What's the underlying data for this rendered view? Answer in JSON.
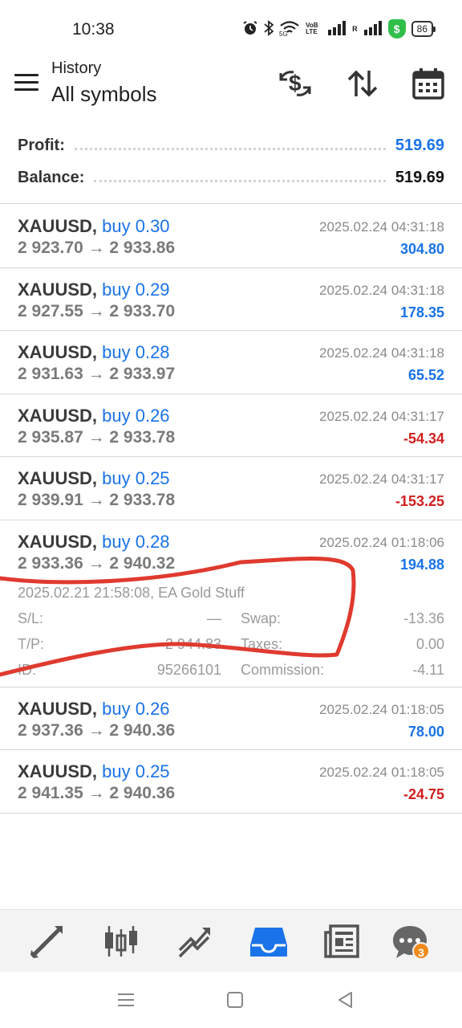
{
  "status": {
    "time": "10:38",
    "network": "5G",
    "volte": "VoB LTE",
    "roaming": "R",
    "shield": "$",
    "battery": "86"
  },
  "header": {
    "subtitle": "History",
    "title": "All symbols"
  },
  "summary": {
    "profit_label": "Profit:",
    "profit_value": "519.69",
    "balance_label": "Balance:",
    "balance_value": "519.69"
  },
  "trades": [
    {
      "symbol": "XAUUSD,",
      "side": "buy 0.30",
      "prices": "2 923.70 → 2 933.86",
      "time": "2025.02.24 04:31:18",
      "profit": "304.80",
      "positive": true
    },
    {
      "symbol": "XAUUSD,",
      "side": "buy 0.29",
      "prices": "2 927.55 → 2 933.70",
      "time": "2025.02.24 04:31:18",
      "profit": "178.35",
      "positive": true
    },
    {
      "symbol": "XAUUSD,",
      "side": "buy 0.28",
      "prices": "2 931.63 → 2 933.97",
      "time": "2025.02.24 04:31:18",
      "profit": "65.52",
      "positive": true
    },
    {
      "symbol": "XAUUSD,",
      "side": "buy 0.26",
      "prices": "2 935.87 → 2 933.78",
      "time": "2025.02.24 04:31:17",
      "profit": "-54.34",
      "positive": false
    },
    {
      "symbol": "XAUUSD,",
      "side": "buy 0.25",
      "prices": "2 939.91 → 2 933.78",
      "time": "2025.02.24 04:31:17",
      "profit": "-153.25",
      "positive": false
    },
    {
      "symbol": "XAUUSD,",
      "side": "buy 0.28",
      "prices": "2 933.36 → 2 940.32",
      "time": "2025.02.24 01:18:06",
      "profit": "194.88",
      "positive": true,
      "detail": {
        "open_info": "2025.02.21 21:58:08, EA Gold Stuff",
        "sl_label": "S/L:",
        "sl_value": "—",
        "tp_label": "T/P:",
        "tp_value": "2 944.83",
        "id_label": "ID:",
        "id_value": "95266101",
        "swap_label": "Swap:",
        "swap_value": "-13.36",
        "taxes_label": "Taxes:",
        "taxes_value": "0.00",
        "commission_label": "Commission:",
        "commission_value": "-4.11"
      }
    },
    {
      "symbol": "XAUUSD,",
      "side": "buy 0.26",
      "prices": "2 937.36 → 2 940.36",
      "time": "2025.02.24 01:18:05",
      "profit": "78.00",
      "positive": true
    },
    {
      "symbol": "XAUUSD,",
      "side": "buy 0.25",
      "prices": "2 941.35 → 2 940.36",
      "time": "2025.02.24 01:18:05",
      "profit": "-24.75",
      "positive": false
    }
  ],
  "bottom_nav": {
    "items": [
      "quotes-icon",
      "chart-icon",
      "trade-icon",
      "history-icon",
      "news-icon",
      "chat-icon"
    ],
    "active": "history-icon",
    "chat_badge": "3"
  },
  "colors": {
    "accent": "#1a73e8",
    "negative": "#d01f1f",
    "scribble": "#e03a2f"
  }
}
